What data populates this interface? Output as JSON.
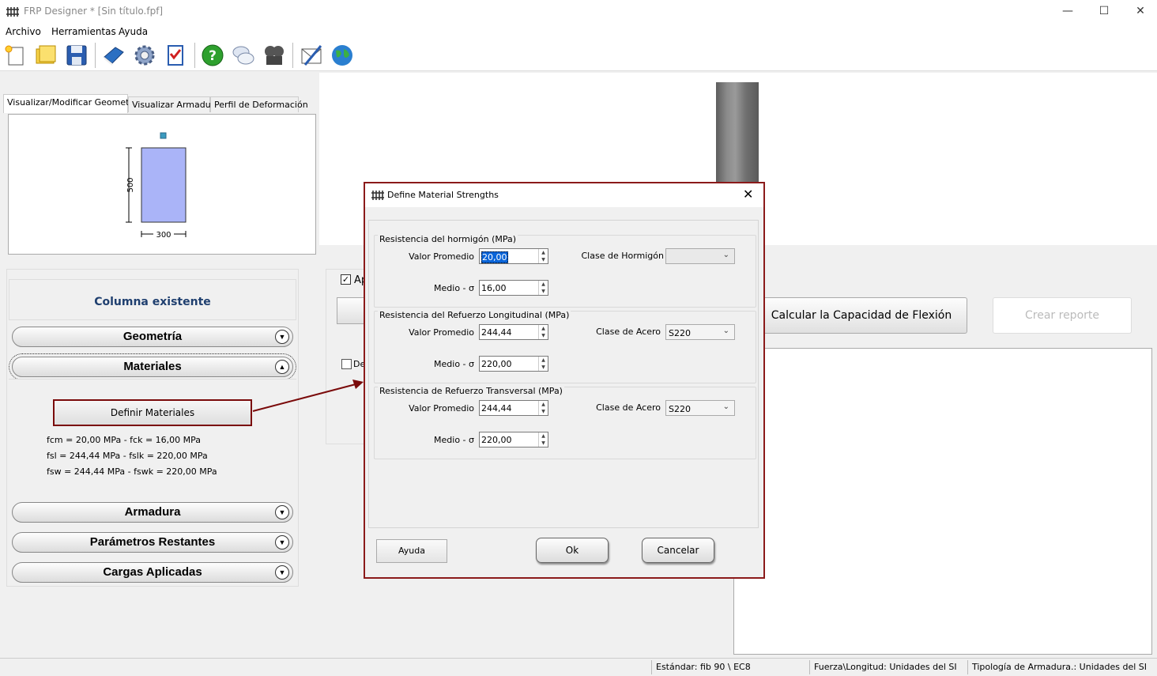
{
  "window": {
    "title": "FRP Designer * [Sin título.fpf]",
    "minimize": "—",
    "maximize": "☐",
    "close": "✕"
  },
  "menu": {
    "items": [
      "Archivo",
      "Herramientas",
      "Ayuda"
    ]
  },
  "toolbar": {
    "icons": [
      "new-file-icon",
      "open-folder-icon",
      "save-icon",
      "book-icon",
      "settings-gear-icon",
      "checklist-icon",
      "help-icon",
      "chat-icon",
      "video-reel-icon",
      "email-icon",
      "globe-icon"
    ]
  },
  "left_tabs": {
    "tab1": "Visualizar/Modificar Geometría",
    "tab2": "Visualizar Armadura",
    "tab3": "Perfil de Deformación"
  },
  "geometry": {
    "height_dim": "500",
    "width_dim": "300"
  },
  "sections": {
    "title": "Columna existente",
    "geometria": "Geometría",
    "materiales": "Materiales",
    "armadura": "Armadura",
    "parametros": "Parámetros Restantes",
    "cargas": "Cargas Aplicadas",
    "define_btn": "Definir Materiales",
    "line1": "fcm = 20,00 MPa   -   fck = 16,00 MPa",
    "line2": "fsl = 244,44 MPa   -   fslk = 220,00 MPa",
    "line3": "fsw = 244,44 MPa   -   fswk = 220,00 MPa"
  },
  "right": {
    "calc_btn": "Calcular la Capacidad de Flexión",
    "report_btn": "Crear reporte",
    "chk_label_1": "Ap",
    "chk_label_2": "De"
  },
  "status": {
    "estandar": "Estándar: fib 90 \\ EC8",
    "units": "Fuerza\\Longitud: Unidades del SI",
    "tipologia": "Tipología de Armadura.: Unidades del SI"
  },
  "dialog": {
    "title": "Define Material Strengths",
    "g1": {
      "title": "Resistencia del hormigón (MPa)",
      "l1": "Valor Promedio",
      "v1": "20,00",
      "l2": "Medio - σ",
      "v2": "16,00",
      "combo_label": "Clase de Hormigón",
      "combo_val": ""
    },
    "g2": {
      "title": "Resistencia del Refuerzo Longitudinal (MPa)",
      "l1": "Valor Promedio",
      "v1": "244,44",
      "l2": "Medio - σ",
      "v2": "220,00",
      "combo_label": "Clase de Acero",
      "combo_val": "S220"
    },
    "g3": {
      "title": "Resistencia de Refuerzo Transversal (MPa)",
      "l1": "Valor Promedio",
      "v1": "244,44",
      "l2": "Medio - σ",
      "v2": "220,00",
      "combo_label": "Clase de Acero",
      "combo_val": "S220"
    },
    "ayuda": "Ayuda",
    "ok": "Ok",
    "cancel": "Cancelar"
  },
  "colors": {
    "dialog_border": "#8b1a1a",
    "section_title": "#1f3f6f",
    "geometry_fill": "#aab4f8",
    "rebar": "#3b9bbf"
  }
}
